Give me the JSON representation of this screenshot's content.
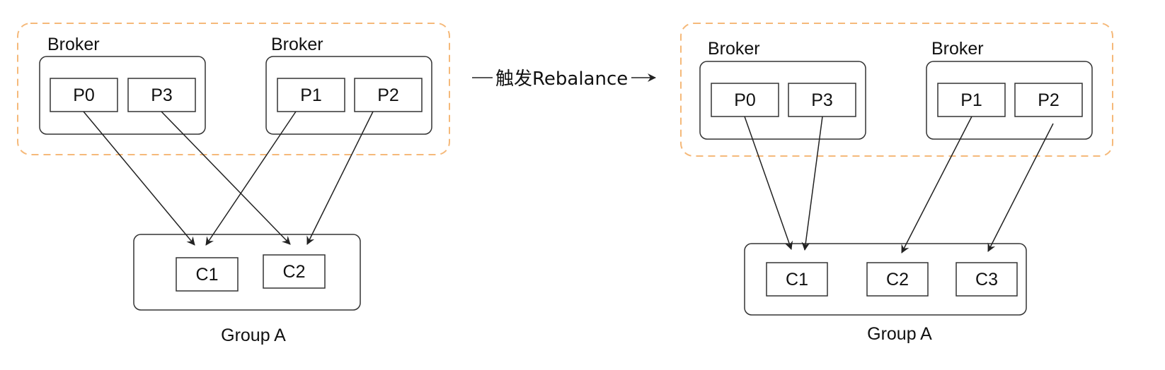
{
  "trigger": {
    "label": "触发Rebalance"
  },
  "before": {
    "brokers": [
      {
        "label": "Broker",
        "partitions": [
          "P0",
          "P3"
        ]
      },
      {
        "label": "Broker",
        "partitions": [
          "P1",
          "P2"
        ]
      }
    ],
    "group": {
      "label": "Group A",
      "consumers": [
        "C1",
        "C2"
      ]
    },
    "assignments": [
      {
        "from": "P0",
        "to": "C1"
      },
      {
        "from": "P3",
        "to": "C2"
      },
      {
        "from": "P1",
        "to": "C1"
      },
      {
        "from": "P2",
        "to": "C2"
      }
    ]
  },
  "after": {
    "brokers": [
      {
        "label": "Broker",
        "partitions": [
          "P0",
          "P3"
        ]
      },
      {
        "label": "Broker",
        "partitions": [
          "P1",
          "P2"
        ]
      }
    ],
    "group": {
      "label": "Group A",
      "consumers": [
        "C1",
        "C2",
        "C3"
      ]
    },
    "assignments": [
      {
        "from": "P0",
        "to": "C1"
      },
      {
        "from": "P3",
        "to": "C1"
      },
      {
        "from": "P1",
        "to": "C2"
      },
      {
        "from": "P2",
        "to": "C3"
      }
    ]
  },
  "colors": {
    "cluster_border": "#f5b97a",
    "box_border": "#333333",
    "arrow": "#222222"
  }
}
